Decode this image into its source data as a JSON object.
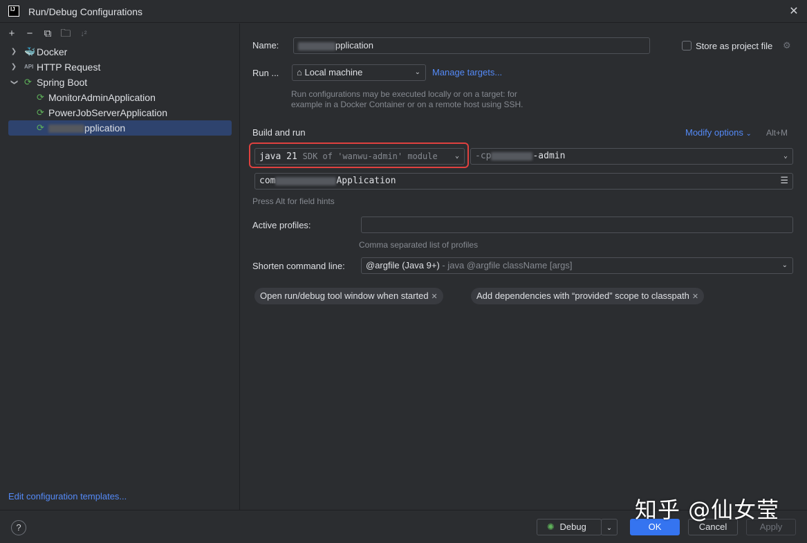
{
  "window": {
    "title": "Run/Debug Configurations"
  },
  "toolbar": {
    "add_icon": "plus-icon",
    "remove_icon": "minus-icon",
    "copy_icon": "copy-icon",
    "folder_icon": "new-folder-icon",
    "sort_icon": "sort-icon"
  },
  "tree": {
    "groups": [
      {
        "label": "Docker",
        "icon": "docker-icon"
      },
      {
        "label": "HTTP Request",
        "icon": "api-icon"
      },
      {
        "label": "Spring Boot",
        "icon": "spring-boot-icon"
      }
    ],
    "spring_children": [
      {
        "label": "MonitorAdminApplication"
      },
      {
        "label": "PowerJobServerApplication"
      },
      {
        "label": "pplication"
      }
    ]
  },
  "left_footer": {
    "edit_templates": "Edit configuration templates..."
  },
  "form": {
    "name_label": "Name:",
    "name_value": "pplication",
    "store_label": "Store as project file",
    "run_on_label": "Run ...",
    "run_on_value": "Local machine",
    "manage_targets": "Manage targets...",
    "run_on_hint_1": "Run configurations may be executed locally or on a target: for",
    "run_on_hint_2": "example in a Docker Container or on a remote host using SSH.",
    "build_run_title": "Build and run",
    "modify_options": "Modify options",
    "modify_shortcut": "Alt+M",
    "jdk_main": "java 21",
    "jdk_detail": "SDK of 'wanwu-admin' module",
    "cp_prefix": "-cp",
    "cp_suffix": "-admin",
    "main_class_prefix": "com",
    "main_class_suffix": "Application",
    "field_hint": "Press Alt for field hints",
    "profiles_label": "Active profiles:",
    "profiles_value": "",
    "profiles_hint": "Comma separated list of profiles",
    "shorten_label": "Shorten command line:",
    "shorten_value": "@argfile (Java 9+)",
    "shorten_detail": "- java @argfile className [args]",
    "chip_1": "Open run/debug tool window when started",
    "chip_2": "Add dependencies with “provided” scope to classpath"
  },
  "footer": {
    "help": "?",
    "debug": "Debug",
    "ok": "OK",
    "cancel": "Cancel",
    "apply": "Apply"
  },
  "watermark": "知乎 @仙女莹",
  "colors": {
    "background": "#2b2d30",
    "accent": "#3574f0",
    "link": "#548af7",
    "selection": "#2e436e",
    "highlight_border": "#e0413f"
  }
}
